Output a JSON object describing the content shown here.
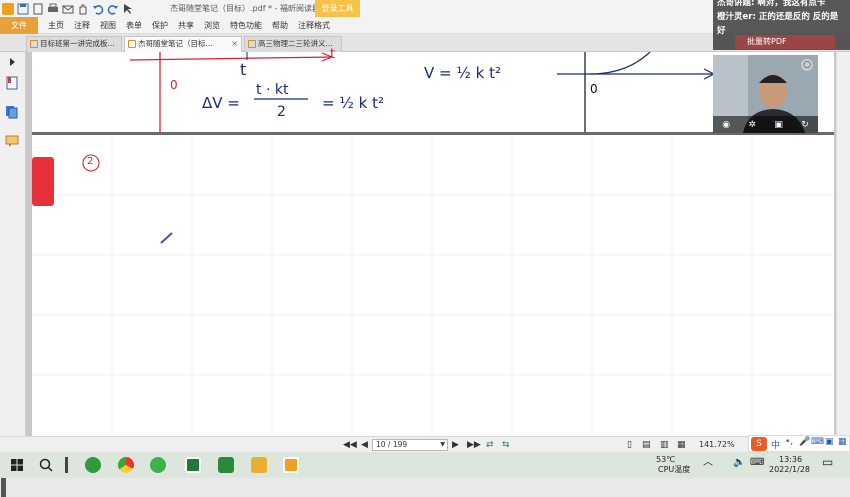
{
  "app": {
    "doc_title": "杰哥随堂笔记（目标）.pdf * - 福昕阅读器",
    "login_label": "登录工具"
  },
  "menu": {
    "file": "文件",
    "items": [
      "主页",
      "注释",
      "视图",
      "表单",
      "保护",
      "共享",
      "浏览",
      "特色功能",
      "帮助",
      "注释格式"
    ]
  },
  "tabs": [
    {
      "label": "目标班第一讲完成板...",
      "active": false
    },
    {
      "label": "杰哥随堂笔记（目标...",
      "active": true
    },
    {
      "label": "高三物理二三轮讲义...",
      "active": false
    }
  ],
  "handwriting": {
    "top_label_t": "t",
    "top_label_t2": "t",
    "origin_label": "0",
    "formula_a": "ΔV =",
    "frac_num": "t · kt",
    "frac_den": "2",
    "eq_result": "= ½ k t²",
    "formula_b": "V = ½ k t²",
    "graph_origin": "0",
    "circled_number": "2"
  },
  "page_nav": {
    "current": "10 / 199",
    "zoom": "141.72%"
  },
  "chat": {
    "line1": "杰哥讲题: 啊对，我这有点卡",
    "line2": "橙汁灵er: 正的还是反的 反的是",
    "line3": "好",
    "button": "批量转PDF"
  },
  "tray": {
    "temp": "53℃",
    "temp_label": "CPU温度",
    "ime": "中",
    "time": "13:36",
    "date": "2022/1/28"
  },
  "colors": {
    "accent_orange": "#e8a13a",
    "red_tab": "#e8303a",
    "ink_blue": "#1a2a7a",
    "ink_red": "#e02030"
  }
}
